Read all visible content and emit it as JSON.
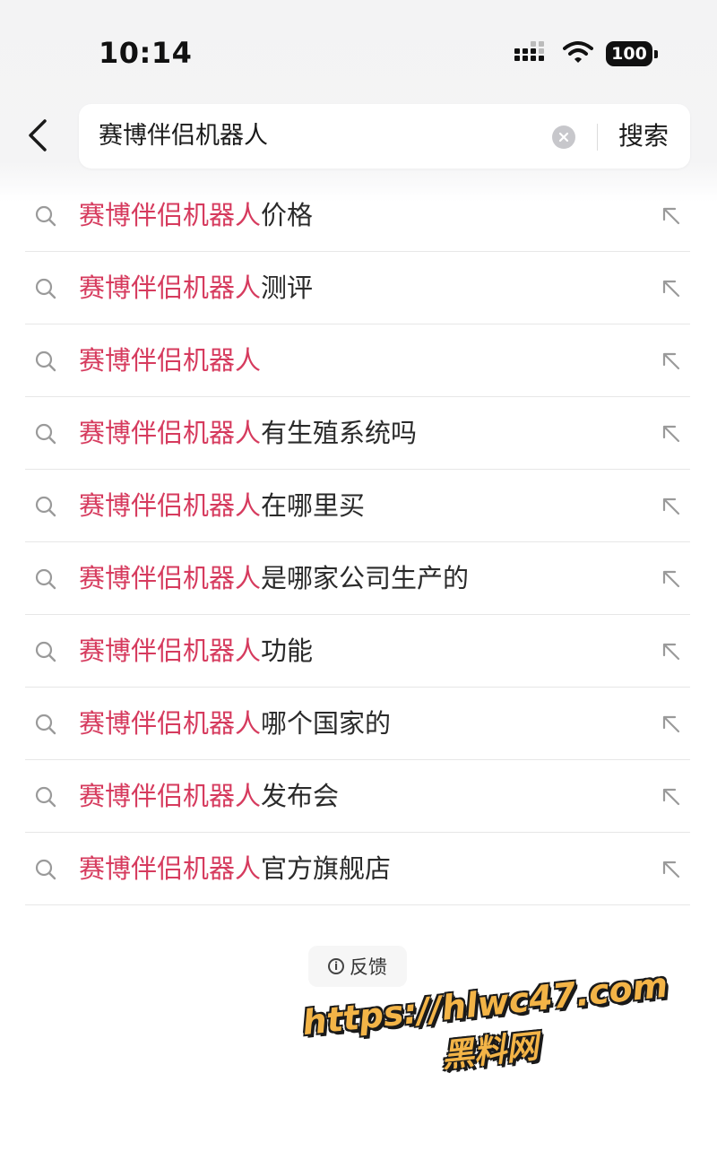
{
  "status_bar": {
    "time": "10:14",
    "battery": "100"
  },
  "search": {
    "query": "赛博伴侣机器人",
    "button_label": "搜索"
  },
  "suggestions": [
    {
      "highlight": "赛博伴侣机器人",
      "rest": "价格"
    },
    {
      "highlight": "赛博伴侣机器人",
      "rest": "测评"
    },
    {
      "highlight": "赛博伴侣机器人",
      "rest": ""
    },
    {
      "highlight": "赛博伴侣机器人",
      "rest": "有生殖系统吗"
    },
    {
      "highlight": "赛博伴侣机器人",
      "rest": "在哪里买"
    },
    {
      "highlight": "赛博伴侣机器人",
      "rest": "是哪家公司生产的"
    },
    {
      "highlight": "赛博伴侣机器人",
      "rest": "功能"
    },
    {
      "highlight": "赛博伴侣机器人",
      "rest": "哪个国家的"
    },
    {
      "highlight": "赛博伴侣机器人",
      "rest": "发布会"
    },
    {
      "highlight": "赛博伴侣机器人",
      "rest": "官方旗舰店"
    }
  ],
  "feedback": {
    "label": "反馈",
    "icon_glyph": "i"
  },
  "watermark": {
    "url": "https://hlwc47.com",
    "name": "黑料网"
  },
  "colors": {
    "highlight": "#d63b5e",
    "watermark": "#f3b447"
  },
  "icons": {
    "back": "chevron-left-icon",
    "clear": "clear-circle-icon",
    "suggestion": "search-icon",
    "fill": "arrow-up-left-icon",
    "signal": "signal-icon",
    "wifi": "wifi-icon"
  }
}
